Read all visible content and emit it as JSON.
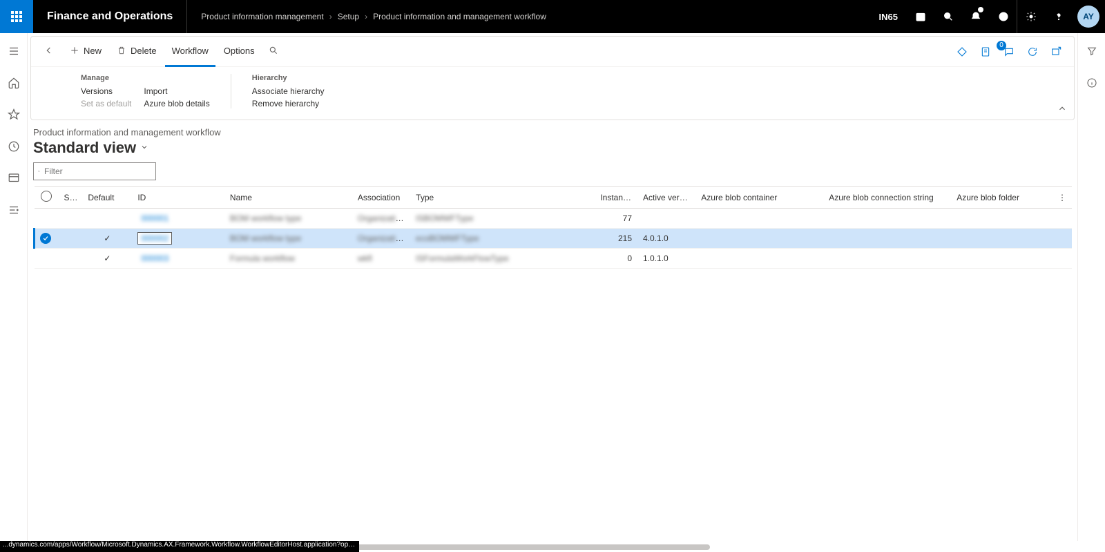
{
  "topbar": {
    "appTitle": "Finance and Operations",
    "entity": "IN65",
    "avatar": "AY",
    "messageCount": "0"
  },
  "breadcrumb": {
    "items": [
      "Product information management",
      "Setup",
      "Product information and management workflow"
    ]
  },
  "cmdbar": {
    "new": "New",
    "delete": "Delete",
    "workflow": "Workflow",
    "options": "Options"
  },
  "ribbon": {
    "manage": {
      "title": "Manage",
      "versions": "Versions",
      "setDefault": "Set as default",
      "import": "Import",
      "blobDetails": "Azure blob details"
    },
    "hierarchy": {
      "title": "Hierarchy",
      "associate": "Associate hierarchy",
      "remove": "Remove hierarchy"
    }
  },
  "page": {
    "caption": "Product information and management workflow",
    "viewName": "Standard view",
    "filterPlaceholder": "Filter"
  },
  "grid": {
    "headers": {
      "status": "St...",
      "default": "Default",
      "id": "ID",
      "name": "Name",
      "association": "Association",
      "type": "Type",
      "instances": "Instances",
      "activeVersion": "Active version",
      "blobContainer": "Azure blob container",
      "blobConn": "Azure blob connection string",
      "blobFolder": "Azure blob folder"
    },
    "rows": [
      {
        "selected": false,
        "defaultCheck": false,
        "id": "000001",
        "name": "BOM workflow type",
        "assoc": "Organizatio...",
        "type": "ISBOMWFType",
        "instances": "77",
        "active": ""
      },
      {
        "selected": true,
        "defaultCheck": true,
        "id": "000002",
        "name": "BOM workflow type",
        "assoc": "Organizatio...",
        "type": "ecoBOMWFType",
        "instances": "215",
        "active": "4.0.1.0"
      },
      {
        "selected": false,
        "defaultCheck": true,
        "id": "000003",
        "name": "Formula workflow",
        "assoc": "wkfl",
        "type": "ISFormulaWorkFlowType",
        "instances": "0",
        "active": "1.0.1.0"
      }
    ]
  },
  "statusUrl": "...dynamics.com/apps/Workflow/Microsoft.Dynamics.AX.Framework.Workflow.WorkflowEditorHost.application?open..."
}
